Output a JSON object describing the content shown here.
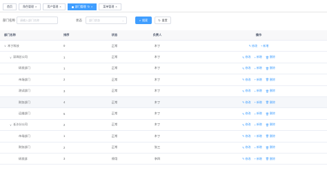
{
  "tags": [
    {
      "label": "首页",
      "active": false
    },
    {
      "label": "角色管理",
      "active": false
    },
    {
      "label": "用户管理",
      "active": false
    },
    {
      "label": "部门管理",
      "active": true
    },
    {
      "label": "菜单管理",
      "active": false
    }
  ],
  "search": {
    "dept_label": "部门名称",
    "dept_placeholder": "请输入部门名称",
    "status_label": "状态",
    "status_placeholder": "部门状态",
    "search_btn": "搜索",
    "reset_btn": "重置"
  },
  "table": {
    "headers": {
      "name": "部门名称",
      "sort": "排序",
      "status": "状态",
      "leader": "负责人",
      "ops": "操作"
    },
    "ops": {
      "edit": "修改",
      "add": "新增",
      "delete": "删除"
    },
    "rows": [
      {
        "name": "木丁科技",
        "level": 0,
        "caret": "∨",
        "sort": "0",
        "status": "正常",
        "leader": "木丁",
        "ops": [
          "edit",
          "add"
        ]
      },
      {
        "name": "深圳总公司",
        "level": 1,
        "caret": "∨",
        "sort": "1",
        "status": "正常",
        "leader": "木丁",
        "ops": [
          "edit",
          "add",
          "delete"
        ]
      },
      {
        "name": "研发部门",
        "level": 2,
        "caret": "",
        "sort": "1",
        "status": "正常",
        "leader": "木丁",
        "ops": [
          "edit",
          "add",
          "delete"
        ]
      },
      {
        "name": "市场部门",
        "level": 2,
        "caret": "",
        "sort": "2",
        "status": "正常",
        "leader": "木丁",
        "ops": [
          "edit",
          "add",
          "delete"
        ]
      },
      {
        "name": "测试部门",
        "level": 2,
        "caret": "",
        "sort": "3",
        "status": "正常",
        "leader": "木丁",
        "ops": [
          "edit",
          "add",
          "delete"
        ]
      },
      {
        "name": "财务部门",
        "level": 2,
        "caret": "",
        "sort": "4",
        "status": "正常",
        "leader": "木丁",
        "ops": [
          "edit",
          "add",
          "delete"
        ],
        "highlight": true
      },
      {
        "name": "运维部门",
        "level": 2,
        "caret": "",
        "sort": "5",
        "status": "正常",
        "leader": "木丁",
        "ops": [
          "edit",
          "add",
          "delete"
        ]
      },
      {
        "name": "长沙分公司",
        "level": 1,
        "caret": "∨",
        "sort": "2",
        "status": "正常",
        "leader": "木丁",
        "ops": [
          "edit",
          "add",
          "delete"
        ]
      },
      {
        "name": "市场部门",
        "level": 2,
        "caret": "",
        "sort": "1",
        "status": "正常",
        "leader": "木丁",
        "ops": [
          "edit",
          "add",
          "delete"
        ]
      },
      {
        "name": "财务部门",
        "level": 2,
        "caret": "",
        "sort": "2",
        "status": "正常",
        "leader": "张三",
        "ops": [
          "edit",
          "add",
          "delete"
        ]
      },
      {
        "name": "研发部",
        "level": 2,
        "caret": "",
        "sort": "3",
        "status": "停用",
        "leader": "李四",
        "ops": [
          "edit",
          "add",
          "delete"
        ]
      }
    ]
  },
  "colors": {
    "primary": "#409eff",
    "border": "#ebeef5",
    "header_bg": "#f8f8f9"
  }
}
